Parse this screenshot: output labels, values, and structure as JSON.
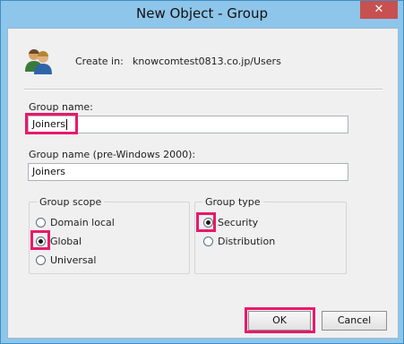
{
  "window": {
    "title": "New Object - Group",
    "close_glyph": "✕"
  },
  "header": {
    "icon": "users-icon",
    "create_in_label": "Create in:",
    "create_in_value": "knowcomtest0813.co.jp/Users"
  },
  "fields": {
    "group_name_label": "Group name:",
    "group_name_value": "Joiners",
    "pre2000_label": "Group name (pre-Windows 2000):",
    "pre2000_value": "Joiners"
  },
  "group_scope": {
    "title": "Group scope",
    "options": [
      {
        "label": "Domain local",
        "checked": false
      },
      {
        "label": "Global",
        "checked": true
      },
      {
        "label": "Universal",
        "checked": false
      }
    ]
  },
  "group_type": {
    "title": "Group type",
    "options": [
      {
        "label": "Security",
        "checked": true
      },
      {
        "label": "Distribution",
        "checked": false
      }
    ]
  },
  "buttons": {
    "ok": "OK",
    "cancel": "Cancel"
  },
  "colors": {
    "highlight": "#e8196b",
    "titlebar": "#8ec5ea"
  }
}
